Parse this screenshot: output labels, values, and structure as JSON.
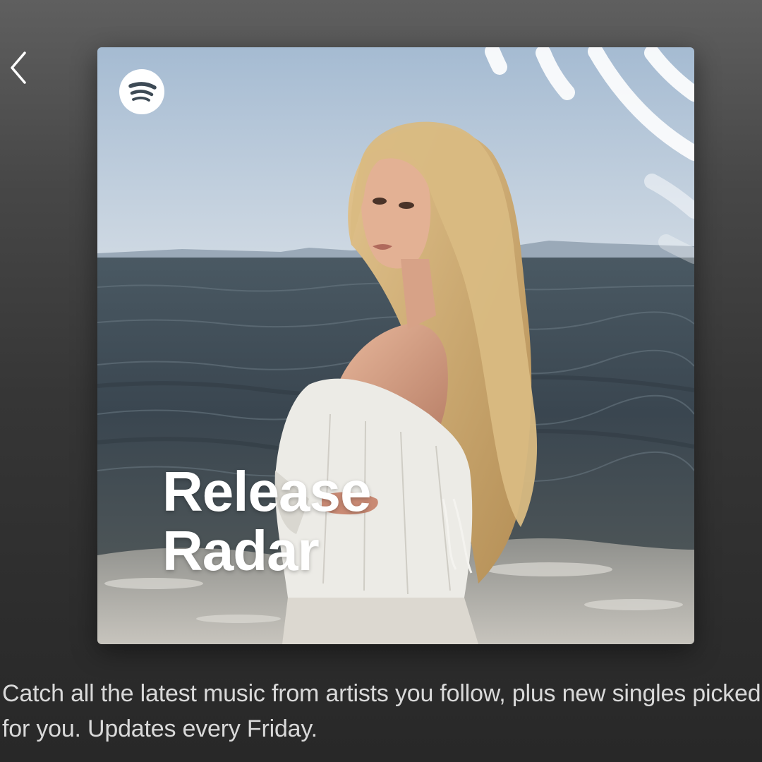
{
  "header": {
    "back_icon": "chevron-left-icon"
  },
  "cover": {
    "logo_icon": "spotify-logo-icon",
    "title_line1": "Release",
    "title_line2": "Radar",
    "colors": {
      "sky_top": "#a9bfd6",
      "sky_bottom": "#c9d6e2",
      "sea": "#3e4a53",
      "foam": "#b9b7b1",
      "hair": "#cfae72",
      "dress": "#ecebe6",
      "skin": "#d8a48a"
    }
  },
  "description": {
    "text": "Catch all the latest music from artists you follow, plus new singles picked for you. Updates every Friday."
  }
}
